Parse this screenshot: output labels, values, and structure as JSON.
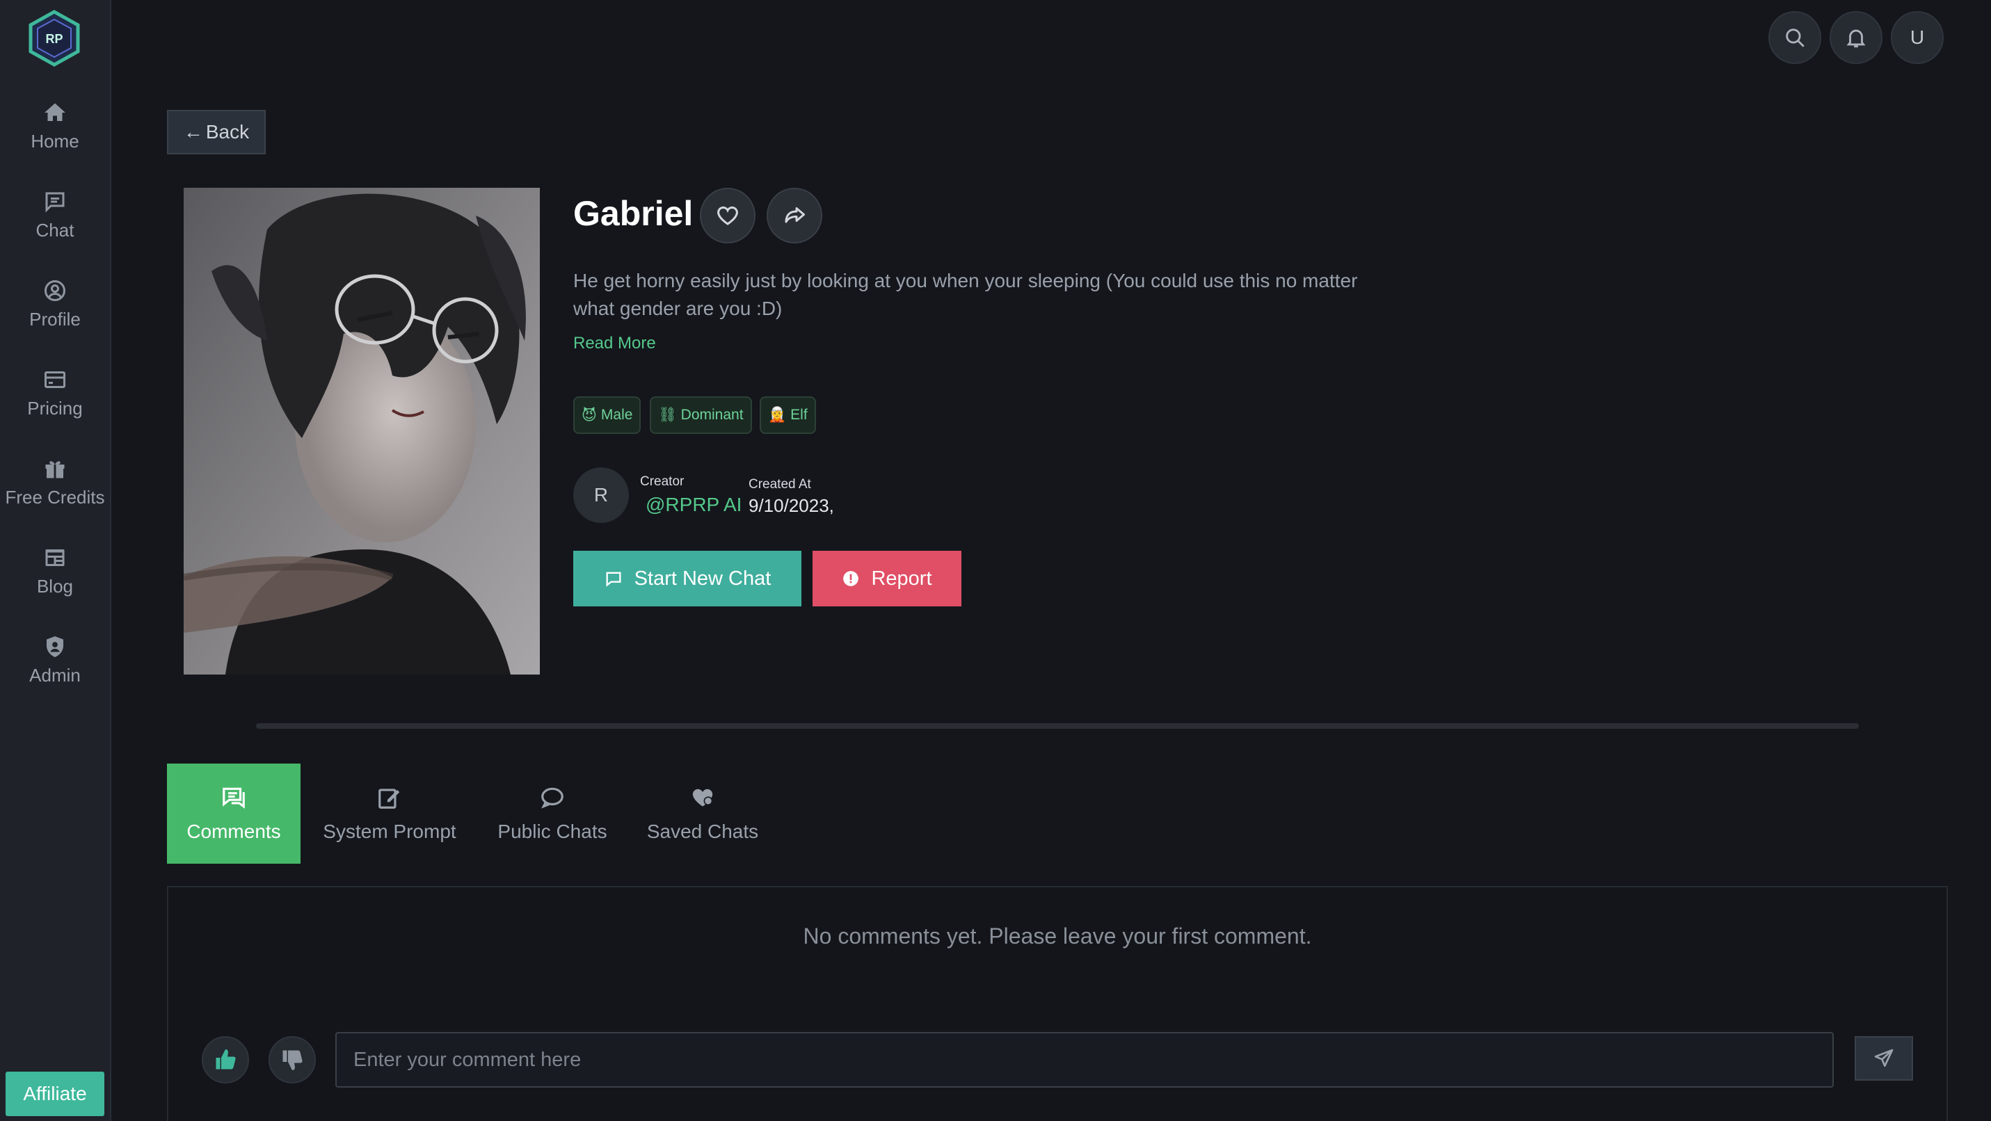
{
  "sidebar": {
    "logo_text": "RP",
    "items": [
      {
        "label": "Home",
        "icon": "home-icon"
      },
      {
        "label": "Chat",
        "icon": "chat-icon"
      },
      {
        "label": "Profile",
        "icon": "user-circle-icon"
      },
      {
        "label": "Pricing",
        "icon": "credit-card-icon"
      },
      {
        "label": "Free Credits",
        "icon": "gift-icon"
      },
      {
        "label": "Blog",
        "icon": "newspaper-icon"
      },
      {
        "label": "Admin",
        "icon": "admin-shield-icon"
      }
    ],
    "affiliate_label": "Affiliate"
  },
  "topbar": {
    "user_initial": "U"
  },
  "back_label": "Back",
  "character": {
    "name": "Gabriel",
    "description": "He get horny easily just by looking at you when your sleeping (You could use this no matter what gender are you :D)",
    "read_more": "Read More",
    "tags": [
      {
        "emoji": "😈",
        "label": "Male"
      },
      {
        "emoji": "⛓",
        "label": "Dominant"
      },
      {
        "emoji": "🧝",
        "label": "Elf"
      }
    ],
    "creator_initial": "R",
    "creator_label": "Creator",
    "creator_name": "@RPRP AI",
    "created_label": "Created At",
    "created_value": "9/10/2023,"
  },
  "actions": {
    "start_chat": "Start New Chat",
    "report": "Report"
  },
  "tabs": [
    {
      "label": "Comments",
      "active": true
    },
    {
      "label": "System Prompt",
      "active": false
    },
    {
      "label": "Public Chats",
      "active": false
    },
    {
      "label": "Saved Chats",
      "active": false
    }
  ],
  "comments": {
    "empty_message": "No comments yet. Please leave your first comment.",
    "input_placeholder": "Enter your comment here"
  },
  "colors": {
    "accent_green": "#46b86a",
    "teal": "#3fae9d",
    "report_red": "#e04f65",
    "link_green": "#54c98a"
  }
}
